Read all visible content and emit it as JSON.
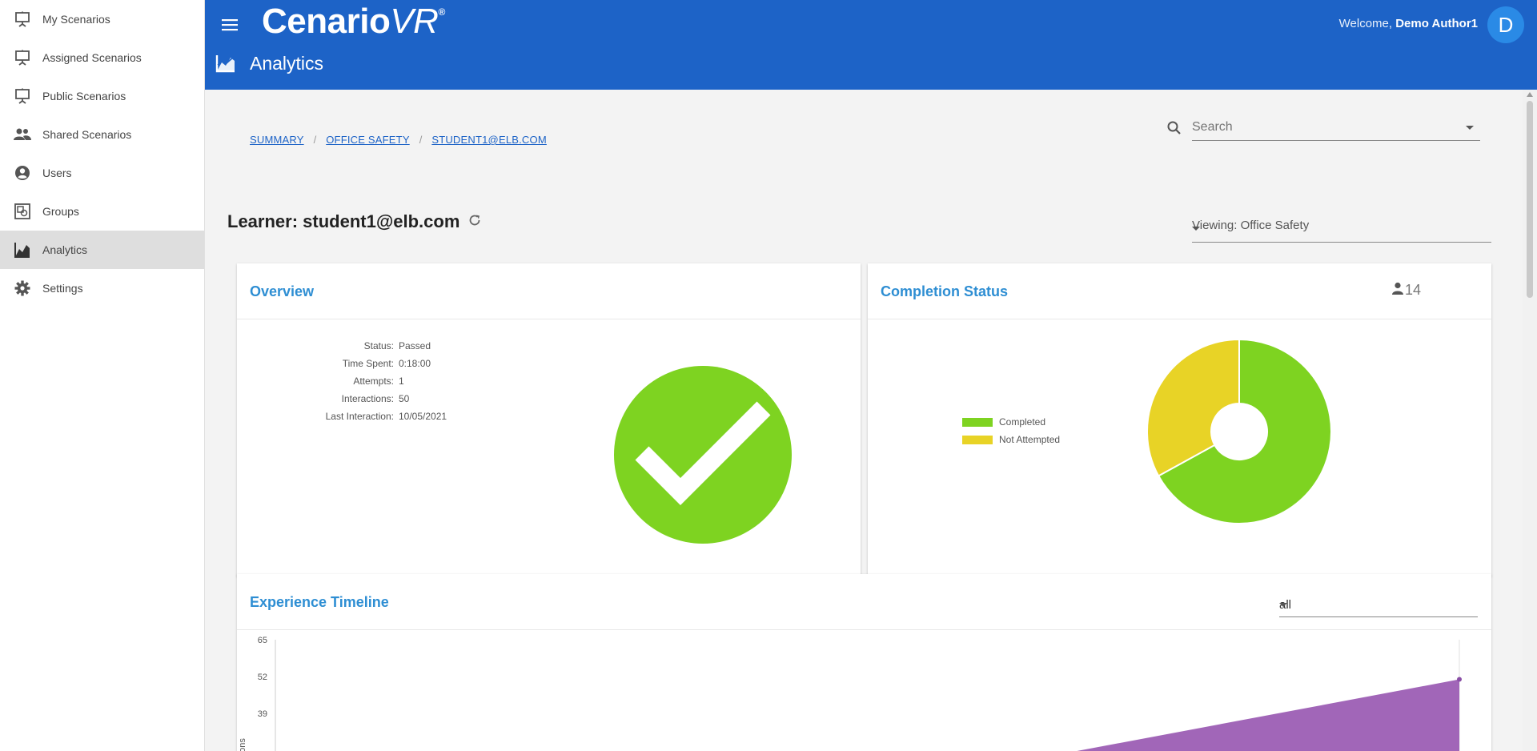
{
  "sidebar": {
    "items": [
      {
        "label": "My Scenarios",
        "icon": "presentation-icon",
        "active": false
      },
      {
        "label": "Assigned Scenarios",
        "icon": "presentation-icon",
        "active": false
      },
      {
        "label": "Public Scenarios",
        "icon": "presentation-icon",
        "active": false
      },
      {
        "label": "Shared Scenarios",
        "icon": "people-icon",
        "active": false
      },
      {
        "label": "Users",
        "icon": "account-circle-icon",
        "active": false
      },
      {
        "label": "Groups",
        "icon": "groups-icon",
        "active": false
      },
      {
        "label": "Analytics",
        "icon": "analytics-chart-icon",
        "active": true
      },
      {
        "label": "Settings",
        "icon": "gear-icon",
        "active": false
      }
    ]
  },
  "header": {
    "brand_main": "Cenario",
    "brand_vr": "VR",
    "brand_reg": "®",
    "page_title": "Analytics",
    "welcome_prefix": "Welcome, ",
    "user_name": "Demo Author1",
    "avatar_initial": "D",
    "color": "#1d63c7"
  },
  "breadcrumb": [
    "SUMMARY",
    "OFFICE SAFETY",
    "STUDENT1@ELB.COM"
  ],
  "search": {
    "placeholder": "Search"
  },
  "learner": {
    "title": "Learner: student1@elb.com"
  },
  "viewing_select": {
    "value": "Viewing: Office Safety"
  },
  "overview": {
    "title": "Overview",
    "rows": [
      {
        "key": "Status:",
        "value": "Passed"
      },
      {
        "key": "Time Spent:",
        "value": "0:18:00"
      },
      {
        "key": "Attempts:",
        "value": "1"
      },
      {
        "key": "Interactions:",
        "value": "50"
      },
      {
        "key": "Last Interaction:",
        "value": "10/05/2021"
      }
    ],
    "status_icon": "checkmark-circle-icon",
    "status_color": "#7ed321"
  },
  "completion": {
    "title": "Completion Status",
    "user_count": "14",
    "legend": [
      {
        "label": "Completed",
        "color": "#7ed321"
      },
      {
        "label": "Not Attempted",
        "color": "#e8d326"
      }
    ]
  },
  "timeline": {
    "title": "Experience Timeline",
    "filter_value": "all",
    "yaxis_fragment": "actions",
    "fill_color": "#a166b8"
  },
  "chart_data": [
    {
      "type": "pie",
      "categories": [
        "Completed",
        "Not Attempted"
      ],
      "values": [
        67,
        33
      ],
      "donut": true
    },
    {
      "type": "area",
      "ylabel": "actions",
      "yticks": [
        65,
        52,
        39
      ],
      "series": [
        {
          "values": [
            0,
            51
          ]
        }
      ]
    }
  ]
}
